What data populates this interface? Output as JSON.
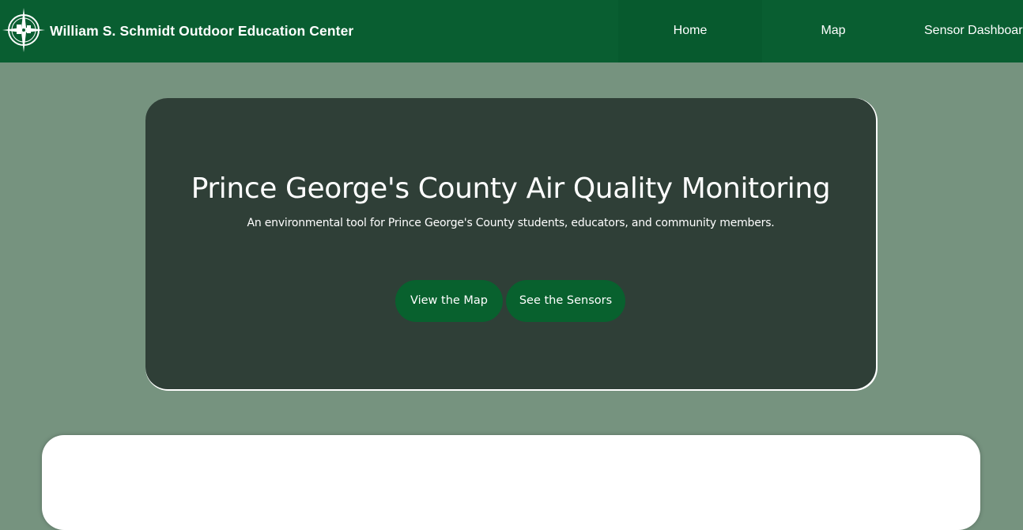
{
  "header": {
    "logo_icon": "compass-rose-seal-icon",
    "title": "William S. Schmidt Outdoor Education Center",
    "nav": [
      {
        "label": "Home",
        "active": true
      },
      {
        "label": "Map",
        "active": false
      },
      {
        "label": "Sensor Dashboard",
        "active": false
      }
    ]
  },
  "hero": {
    "title": "Prince George's County Air Quality Monitoring",
    "subtitle": "An environmental tool for Prince George's County students, educators, and community members.",
    "buttons": [
      {
        "label": "View the Map"
      },
      {
        "label": "See the Sensors"
      }
    ]
  },
  "colors": {
    "header_bg": "#095e31",
    "active_nav_bg": "#075a2e",
    "page_bg": "#76937f",
    "hero_bg": "#2f3f37",
    "button_bg": "#08612e"
  }
}
